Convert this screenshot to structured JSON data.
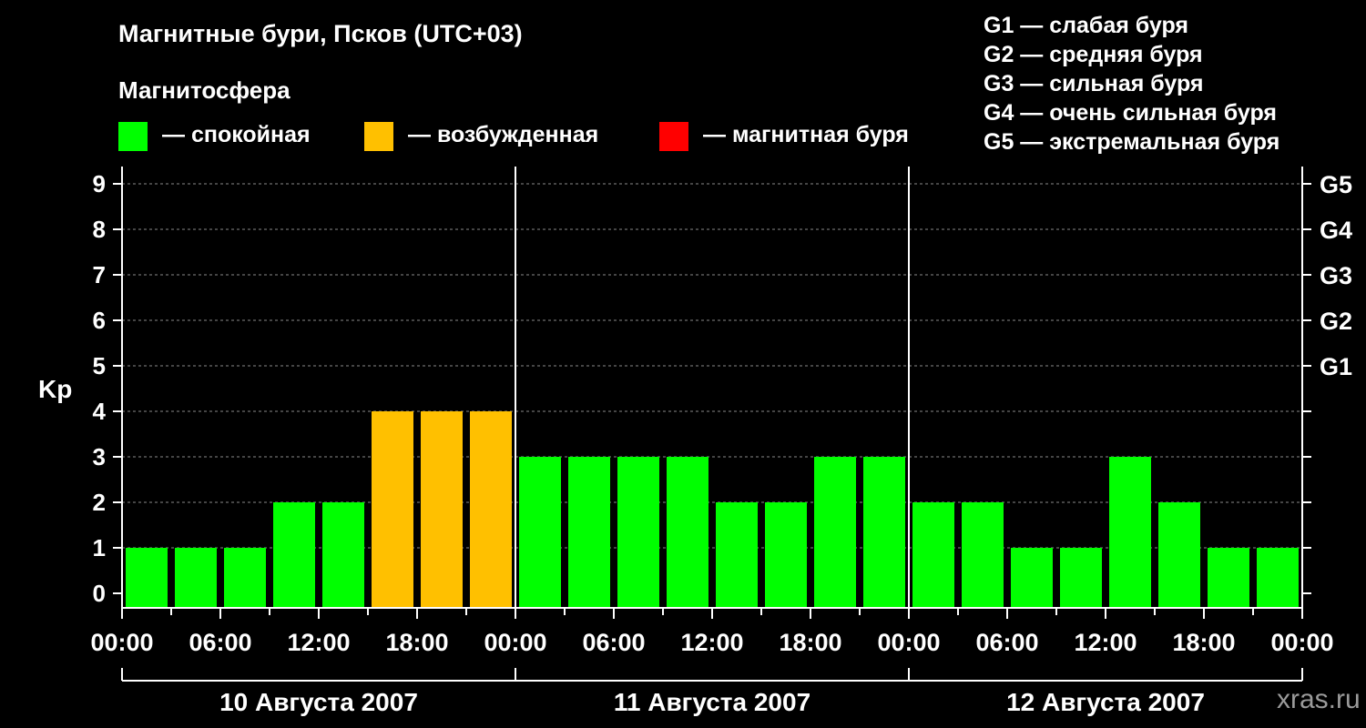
{
  "title": "Магнитные бури, Псков (UTC+03)",
  "legend": {
    "heading": "Магнитосфера",
    "items": [
      {
        "label": "— спокойная",
        "color": "#00ff00"
      },
      {
        "label": "— возбужденная",
        "color": "#ffc000"
      },
      {
        "label": "— магнитная буря",
        "color": "#ff0000"
      }
    ]
  },
  "g_scale_legend": [
    "G1 — слабая буря",
    "G2 — средняя буря",
    "G3 — сильная буря",
    "G4 — очень сильная буря",
    "G5 — экстремальная буря"
  ],
  "watermark": "xras.ru",
  "chart_data": {
    "type": "bar",
    "ylabel": "Kp",
    "ylim": [
      0,
      9
    ],
    "y_ticks": [
      "0",
      "1",
      "2",
      "3",
      "4",
      "5",
      "6",
      "7",
      "8",
      "9"
    ],
    "g_ticks": [
      {
        "kp": 5,
        "label": "G1"
      },
      {
        "kp": 6,
        "label": "G2"
      },
      {
        "kp": 7,
        "label": "G3"
      },
      {
        "kp": 8,
        "label": "G4"
      },
      {
        "kp": 9,
        "label": "G5"
      }
    ],
    "grid": "dashed horizontal",
    "x_tick_labels": [
      "00:00",
      "06:00",
      "12:00",
      "18:00",
      "00:00",
      "06:00",
      "12:00",
      "18:00",
      "00:00",
      "06:00",
      "12:00",
      "18:00",
      "00:00"
    ],
    "days": [
      "10 Августа 2007",
      "11 Августа 2007",
      "12 Августа 2007"
    ],
    "interval_hours": 3,
    "values": [
      1,
      1,
      1,
      2,
      2,
      4,
      4,
      4,
      3,
      3,
      3,
      3,
      2,
      2,
      3,
      3,
      2,
      2,
      1,
      1,
      3,
      2,
      1,
      1
    ],
    "colors": {
      "quiet": "#00ff00",
      "unsettled": "#ffc000",
      "storm": "#ff0000"
    }
  }
}
